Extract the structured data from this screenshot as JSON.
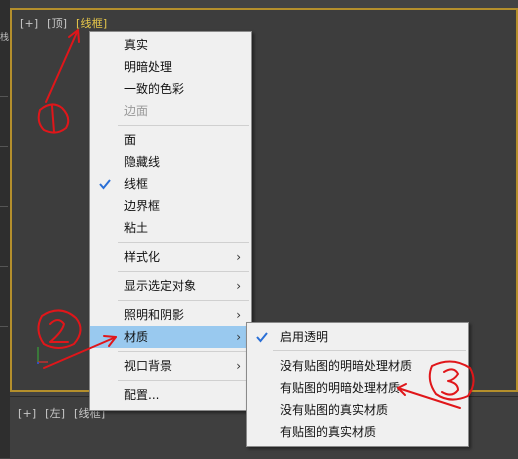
{
  "top_viewport": {
    "label_plus": "[+]",
    "label_view": "[顶]",
    "label_mode": "[线框]"
  },
  "bottom_viewport": {
    "label_plus": "[+]",
    "label_view": "[左]",
    "label_mode": "[线框]"
  },
  "left_strip_char": "栈",
  "main_menu": {
    "items": [
      {
        "label": "真实"
      },
      {
        "label": "明暗处理"
      },
      {
        "label": "一致的色彩"
      },
      {
        "label": "边面"
      },
      {
        "label": "面"
      },
      {
        "label": "隐藏线"
      },
      {
        "label": "线框"
      },
      {
        "label": "边界框"
      },
      {
        "label": "粘土"
      },
      {
        "label": "样式化"
      },
      {
        "label": "显示选定对象"
      },
      {
        "label": "照明和阴影"
      },
      {
        "label": "材质"
      },
      {
        "label": "视口背景"
      },
      {
        "label": "配置..."
      }
    ],
    "submenu_arrow": "›"
  },
  "sub_menu": {
    "items": [
      {
        "label": "启用透明"
      },
      {
        "label": "没有贴图的明暗处理材质"
      },
      {
        "label": "有贴图的明暗处理材质"
      },
      {
        "label": "没有贴图的真实材质"
      },
      {
        "label": "有贴图的真实材质"
      }
    ]
  },
  "annotations": {
    "color": "#e0161a",
    "marks": [
      "1",
      "2",
      "3"
    ]
  },
  "colors": {
    "active_border": "#b48f2c",
    "active_label": "#e8c84a",
    "menu_highlight": "#99c9ef",
    "checkmark": "#2a6fd6"
  }
}
